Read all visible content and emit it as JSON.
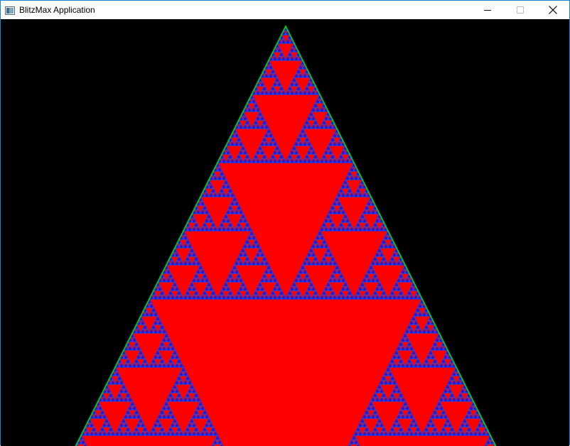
{
  "window": {
    "title": "BlitzMax Application",
    "controls": {
      "minimize_icon": "minimize-icon",
      "maximize_icon": "maximize-icon",
      "close_icon": "close-icon"
    }
  },
  "canvas": {
    "content": "sierpinski-triangle-fractal",
    "colors": {
      "background": "#000000",
      "fill": "#ff0000",
      "outer_edge": "#00ff00",
      "inner_edges": "#0000ff",
      "accent_edges": "#00ffff"
    }
  }
}
